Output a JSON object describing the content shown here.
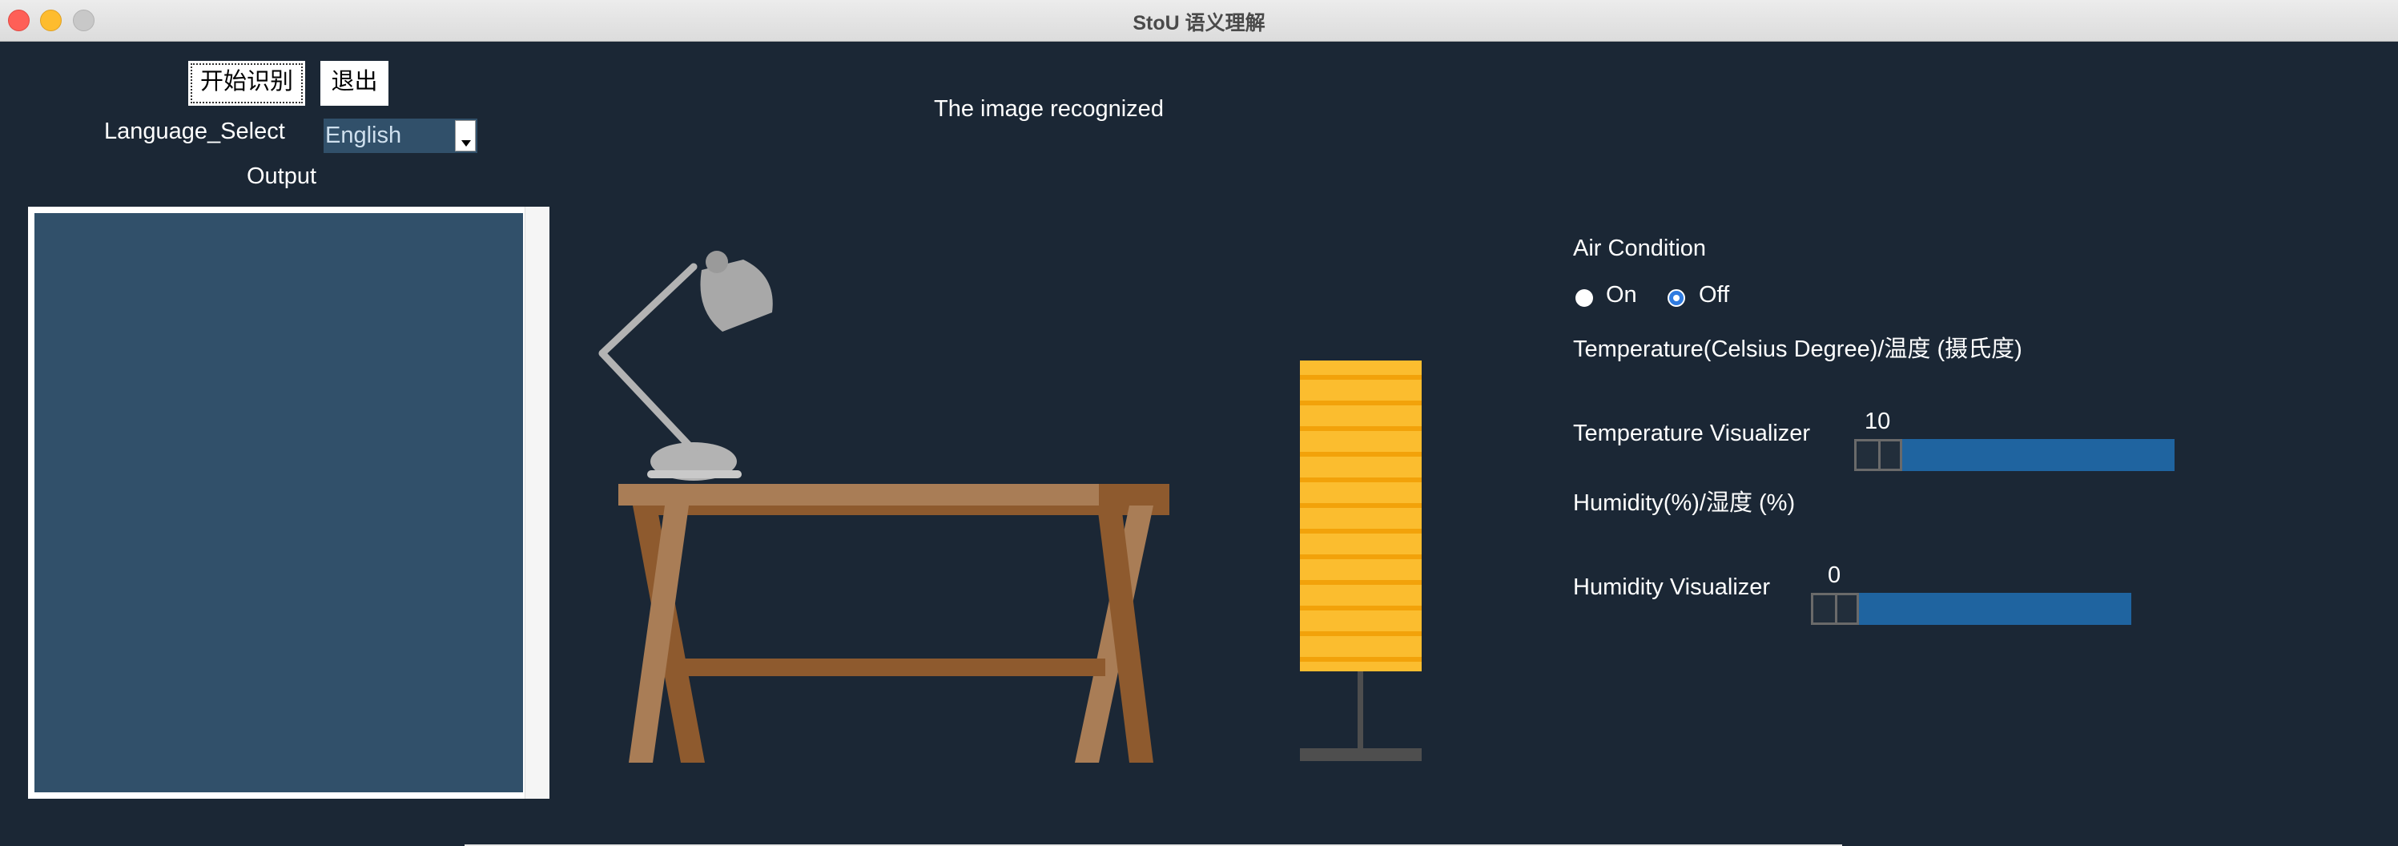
{
  "window": {
    "title": "StoU 语义理解"
  },
  "toolbar": {
    "start_label": "开始识别",
    "exit_label": "退出"
  },
  "language": {
    "label": "Language_Select",
    "selected": "English"
  },
  "output": {
    "label": "Output"
  },
  "image": {
    "caption": "The image recognized"
  },
  "air_condition": {
    "label": "Air Condition",
    "options": [
      {
        "label": "On",
        "selected": false
      },
      {
        "label": "Off",
        "selected": true
      }
    ]
  },
  "temperature": {
    "label": "Temperature(Celsius Degree)/温度 (摄氏度)",
    "visualizer_label": "Temperature Visualizer",
    "value": "10"
  },
  "humidity": {
    "label": "Humidity(%)/湿度 (%)",
    "visualizer_label": "Humidity Visualizer",
    "value": "0"
  },
  "colors": {
    "background": "#1b2735",
    "panel": "#31506a",
    "slider": "#1f64a0",
    "radio_selected": "#2f7be0",
    "lamp_shade": "#fbbd2f",
    "desk": "#8e5a2e"
  }
}
